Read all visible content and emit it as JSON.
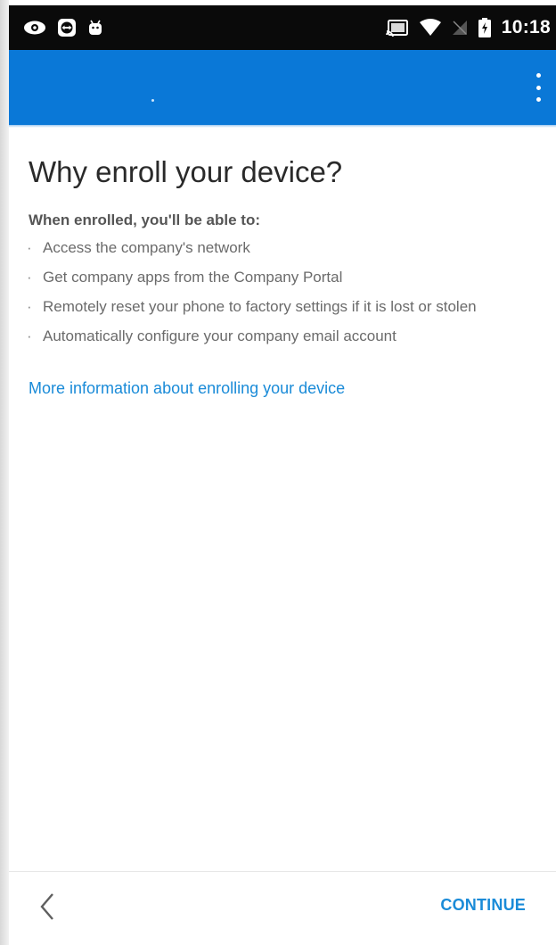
{
  "status_bar": {
    "time": "10:18",
    "icons_left": [
      "eye-icon",
      "teamviewer-icon",
      "android-icon"
    ],
    "icons_right": [
      "cast-icon",
      "wifi-icon",
      "no-signal-icon",
      "battery-charging-icon"
    ]
  },
  "app_bar": {
    "color": "#0a78d7",
    "overflow_icon": "more-vert-icon"
  },
  "main": {
    "title": "Why enroll your device?",
    "intro": "When enrolled, you'll be able to:",
    "bullet_glyph": "·",
    "benefits": [
      "Access the company's network",
      "Get company apps from the Company Portal",
      "Remotely reset your phone to factory settings if it is lost or stolen",
      "Automatically configure your company email account"
    ],
    "more_info_link": "More information about enrolling your device"
  },
  "footer": {
    "back_icon": "chevron-left-icon",
    "continue_label": "CONTINUE",
    "accent": "#1a8bd8"
  }
}
